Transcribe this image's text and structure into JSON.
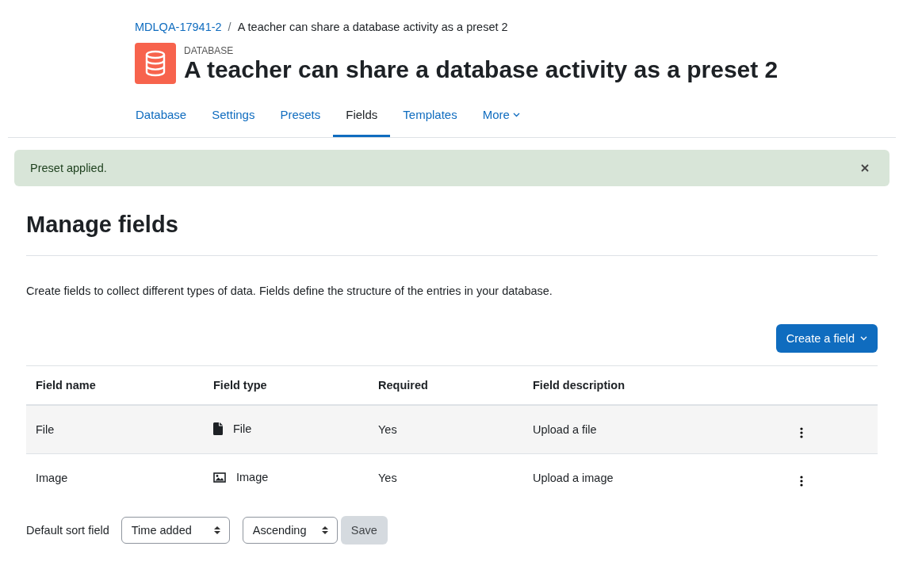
{
  "breadcrumb": [
    {
      "label": "MDLQA-17941-2",
      "link": true
    },
    {
      "label": "A teacher can share a database activity as a preset 2",
      "link": false
    }
  ],
  "breadcrumb_separator": "/",
  "header": {
    "kicker": "DATABASE",
    "title": "A teacher can share a database activity as a preset 2"
  },
  "tabs": [
    {
      "label": "Database",
      "selected": false,
      "dropdown": false
    },
    {
      "label": "Settings",
      "selected": false,
      "dropdown": false
    },
    {
      "label": "Presets",
      "selected": false,
      "dropdown": false
    },
    {
      "label": "Fields",
      "selected": true,
      "dropdown": false
    },
    {
      "label": "Templates",
      "selected": false,
      "dropdown": false
    },
    {
      "label": "More",
      "selected": false,
      "dropdown": true
    }
  ],
  "alert": {
    "message": "Preset applied."
  },
  "heading": "Manage fields",
  "intro": "Create fields to collect different types of data. Fields define the structure of the entries in your database.",
  "create_button": "Create a field",
  "table": {
    "columns": [
      "Field name",
      "Field type",
      "Required",
      "Field description"
    ],
    "rows": [
      {
        "name": "File",
        "type": "File",
        "kind": "file",
        "required": "Yes",
        "description": "Upload a file"
      },
      {
        "name": "Image",
        "type": "Image",
        "kind": "image",
        "required": "Yes",
        "description": "Upload a image"
      }
    ]
  },
  "sort": {
    "label": "Default sort field",
    "field": "Time added",
    "order": "Ascending",
    "save": "Save",
    "save_disabled": true
  }
}
